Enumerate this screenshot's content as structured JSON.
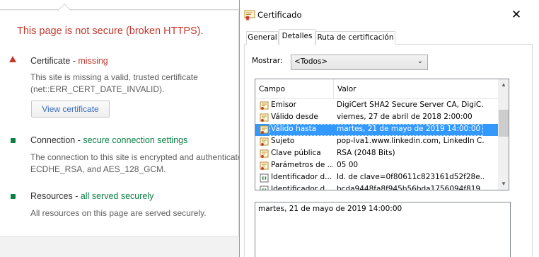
{
  "security_panel": {
    "summary_title": "This page is not secure (broken HTTPS).",
    "sections": [
      {
        "heading": "Certificate - ",
        "status": "missing",
        "status_kind": "bad",
        "description": [
          "This site is missing a valid, trusted certificate",
          "(net::ERR_CERT_DATE_INVALID)."
        ],
        "button_label": "View certificate"
      },
      {
        "heading": "Connection - ",
        "status": "secure connection settings",
        "status_kind": "good",
        "description": [
          "The connection to this site is encrypted and authenticate",
          "ECDHE_RSA, and AES_128_GCM."
        ]
      },
      {
        "heading": "Resources - ",
        "status": "all served securely",
        "status_kind": "good",
        "description": [
          "All resources on this page are served securely."
        ]
      }
    ],
    "colors": {
      "bad": "#c5392c",
      "good": "#0a8043",
      "link": "#3b6ec4"
    }
  },
  "dialog": {
    "title": "Certificado",
    "title_icon": "certificate-icon",
    "close_label": "✕",
    "tabs": [
      {
        "label": "General",
        "active": false
      },
      {
        "label": "Detalles",
        "active": true
      },
      {
        "label": "Ruta de certificación",
        "active": false
      }
    ],
    "show": {
      "label": "Mostrar:",
      "value": "<Todos>"
    },
    "list": {
      "columns": [
        "Campo",
        "Valor"
      ],
      "rows": [
        {
          "field": "Emisor",
          "value": "DigiCert SHA2 Secure Server CA, DigiC...",
          "icon": "cert-field-icon",
          "selected": false
        },
        {
          "field": "Válido desde",
          "value": "viernes, 27 de abril de 2018 2:00:00",
          "icon": "cert-field-icon",
          "selected": false
        },
        {
          "field": "Válido hasta",
          "value": "martes, 21 de mayo de 2019 14:00:00",
          "icon": "cert-field-icon",
          "selected": true
        },
        {
          "field": "Sujeto",
          "value": "pop-lva1.www.linkedin.com, LinkedIn C...",
          "icon": "cert-field-icon",
          "selected": false
        },
        {
          "field": "Clave pública",
          "value": "RSA (2048 Bits)",
          "icon": "cert-field-icon",
          "selected": false
        },
        {
          "field": "Parámetros de ...",
          "value": "05 00",
          "icon": "cert-field-icon",
          "selected": false
        },
        {
          "field": "Identificador d...",
          "value": "Id. de clave=0f80611c823161d52f28e...",
          "icon": "cert-extension-icon",
          "selected": false
        },
        {
          "field": "Identificador d...",
          "value": "bcda9448fa8f945b56bda1756094f819...",
          "icon": "cert-extension-icon",
          "selected": false
        }
      ]
    },
    "detail_value": "martes, 21 de mayo de 2019 14:00:00"
  }
}
